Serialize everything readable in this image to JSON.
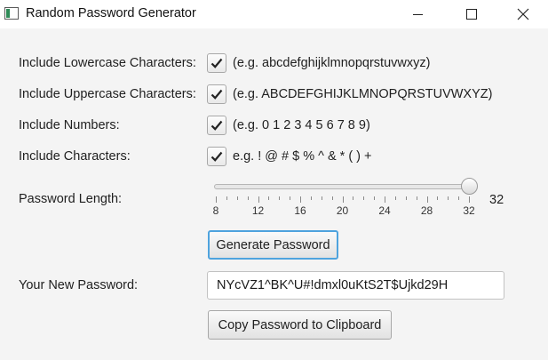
{
  "window": {
    "title": "Random Password Generator",
    "controls": {
      "minimize_icon": "minimize-icon",
      "maximize_icon": "maximize-icon",
      "close_icon": "close-icon"
    }
  },
  "options": [
    {
      "label": "Include Lowercase Characters:",
      "checked": true,
      "hint": "(e.g. abcdefghijklmnopqrstuvwxyz)"
    },
    {
      "label": "Include Uppercase Characters:",
      "checked": true,
      "hint": "(e.g. ABCDEFGHIJKLMNOPQRSTUVWXYZ)"
    },
    {
      "label": "Include Numbers:",
      "checked": true,
      "hint": "(e.g. 0 1 2 3 4 5 6 7 8 9)"
    },
    {
      "label": "Include Characters:",
      "checked": true,
      "hint": "e.g. ! @ # $ % ^ & * ( ) +"
    }
  ],
  "length": {
    "label": "Password Length:",
    "min": 8,
    "max": 32,
    "value": 32,
    "value_text": "32",
    "major_ticks": [
      "8",
      "12",
      "16",
      "20",
      "24",
      "28",
      "32"
    ]
  },
  "generate_button": {
    "label": "Generate Password"
  },
  "result": {
    "label": "Your New Password:",
    "value": "NYcVZ1^BK^U#!dmxl0uKtS2T$Ujkd29H"
  },
  "copy_button": {
    "label": "Copy Password to Clipboard"
  },
  "colors": {
    "focus_border": "#4ea3de",
    "background": "#f4f4f4"
  }
}
